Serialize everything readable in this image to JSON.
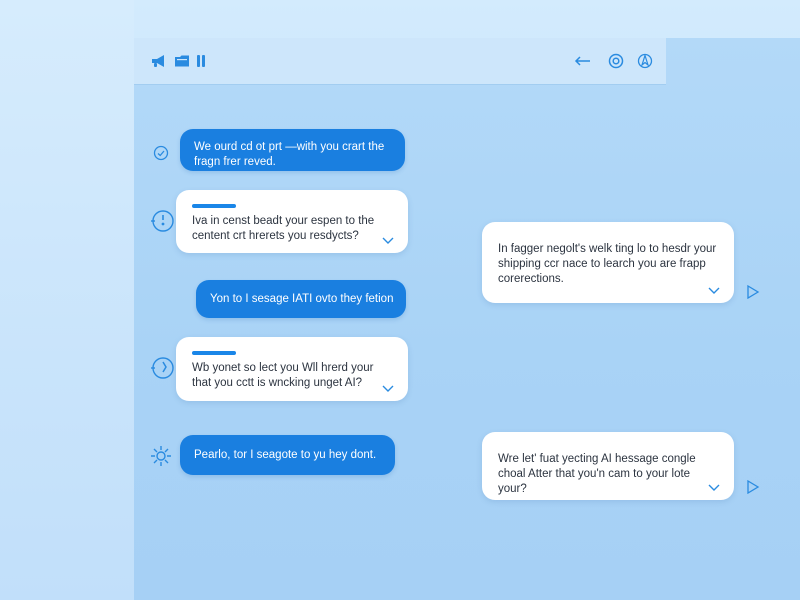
{
  "colors": {
    "accent": "#1a7fe0",
    "icon": "#2a8be0",
    "received_bg": "#ffffff",
    "panel_bg": "#b3d9f8"
  },
  "topbar": {
    "left_icons": [
      "megaphone-icon",
      "folder-icon",
      "pause-icon"
    ],
    "right_icons": [
      "back-arrow-icon",
      "target-icon",
      "compass-icon"
    ]
  },
  "messages": [
    {
      "type": "sent",
      "text": "We ourd cd ot prt —with you crart the fragn frer reved.",
      "icon": "check-circle-icon"
    },
    {
      "type": "received",
      "text": "Iva in censt beadt your espen to the centent crt hrerets you resdycts?",
      "icon": "timer-icon"
    },
    {
      "type": "sent",
      "text": "Yon to I sesage IATI ovto they fetion"
    },
    {
      "type": "received",
      "text": "Wb yonet so lect you Wll hrerd your that you cctt is wncking unget AI?",
      "icon": "timer-icon"
    },
    {
      "type": "sent",
      "text": "Pearlo, tor I seagote to yu hey dont.",
      "icon": "settings-icon"
    },
    {
      "type": "received",
      "text": "In fagger negolt's welk ting lo to hesdr your shipping ccr nace to learch you are frapp corerections."
    },
    {
      "type": "received",
      "text": "Wre let' fuat yecting AI hessage congle choal Atter that you'n cam to your lote your?"
    }
  ]
}
